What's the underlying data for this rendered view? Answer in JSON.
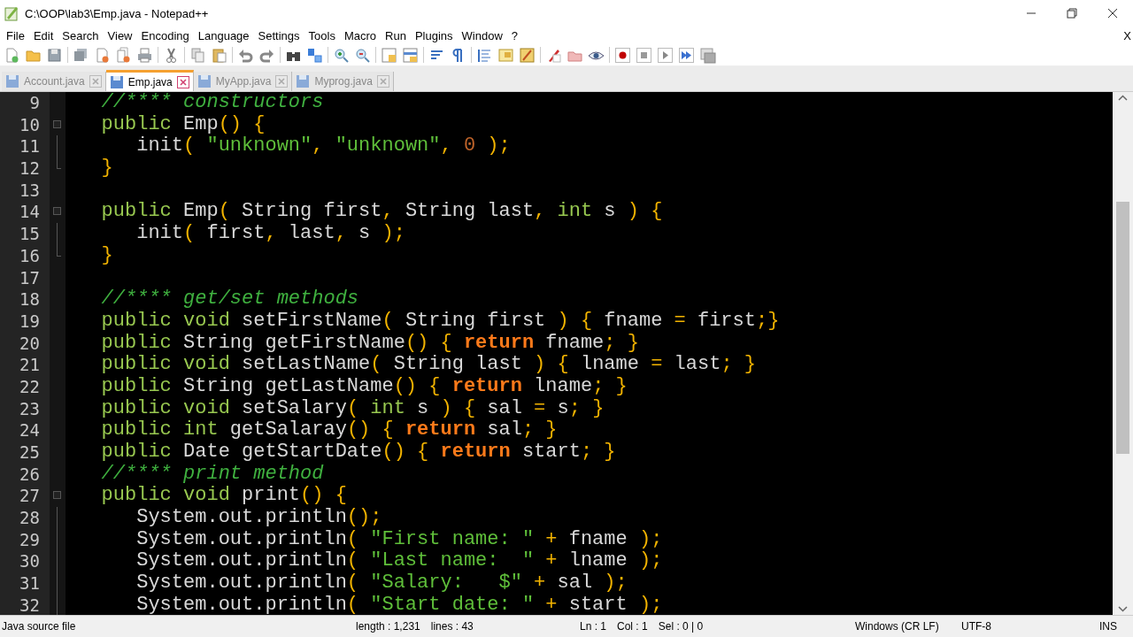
{
  "window": {
    "title": "C:\\OOP\\lab3\\Emp.java - Notepad++",
    "close_document": "X"
  },
  "menu": [
    "File",
    "Edit",
    "Search",
    "View",
    "Encoding",
    "Language",
    "Settings",
    "Tools",
    "Macro",
    "Run",
    "Plugins",
    "Window",
    "?"
  ],
  "tabs": [
    {
      "label": "Account.java",
      "selected": false
    },
    {
      "label": "Emp.java",
      "selected": true
    },
    {
      "label": "MyApp.java",
      "selected": false
    },
    {
      "label": "Myprog.java",
      "selected": false
    }
  ],
  "editor": {
    "lines": [
      {
        "number": "9",
        "kind": "plain",
        "tokens": [
          {
            "kind": "comment",
            "text": "   //**** constructors"
          }
        ]
      },
      {
        "number": "10",
        "kind": "fold_start",
        "tokens": [
          {
            "kind": "keyword",
            "text": "   public"
          },
          {
            "kind": "plain",
            "text": " Emp"
          },
          {
            "kind": "operator",
            "text": "()"
          },
          {
            "kind": "operator",
            "text": " {"
          }
        ]
      },
      {
        "number": "11",
        "kind": "fold_body",
        "tokens": [
          {
            "kind": "plain",
            "text": "      init"
          },
          {
            "kind": "operator",
            "text": "("
          },
          {
            "kind": "string",
            "text": " \"unknown\""
          },
          {
            "kind": "operator",
            "text": ","
          },
          {
            "kind": "string",
            "text": " \"unknown\""
          },
          {
            "kind": "operator",
            "text": ","
          },
          {
            "kind": "number",
            "text": " 0"
          },
          {
            "kind": "operator",
            "text": " );"
          }
        ]
      },
      {
        "number": "12",
        "kind": "fold_end",
        "tokens": [
          {
            "kind": "operator",
            "text": "   }"
          }
        ]
      },
      {
        "number": "13",
        "kind": "plain"
      },
      {
        "number": "14",
        "kind": "fold_start",
        "tokens": [
          {
            "kind": "keyword",
            "text": "   public"
          },
          {
            "kind": "plain",
            "text": " Emp"
          },
          {
            "kind": "operator",
            "text": "("
          },
          {
            "kind": "plain",
            "text": " String first"
          },
          {
            "kind": "operator",
            "text": ","
          },
          {
            "kind": "plain",
            "text": " String last"
          },
          {
            "kind": "operator",
            "text": ","
          },
          {
            "kind": "keyword",
            "text": " int"
          },
          {
            "kind": "plain",
            "text": " s"
          },
          {
            "kind": "operator",
            "text": " )"
          },
          {
            "kind": "operator",
            "text": " {"
          }
        ]
      },
      {
        "number": "15",
        "kind": "fold_body",
        "tokens": [
          {
            "kind": "plain",
            "text": "      init"
          },
          {
            "kind": "operator",
            "text": "("
          },
          {
            "kind": "plain",
            "text": " first"
          },
          {
            "kind": "operator",
            "text": ","
          },
          {
            "kind": "plain",
            "text": " last"
          },
          {
            "kind": "operator",
            "text": ","
          },
          {
            "kind": "plain",
            "text": " s"
          },
          {
            "kind": "operator",
            "text": " );"
          }
        ]
      },
      {
        "number": "16",
        "kind": "fold_end",
        "tokens": [
          {
            "kind": "operator",
            "text": "   }"
          }
        ]
      },
      {
        "number": "17",
        "kind": "plain"
      },
      {
        "number": "18",
        "kind": "plain",
        "tokens": [
          {
            "kind": "comment",
            "text": "   //**** get/set methods"
          }
        ]
      },
      {
        "number": "19",
        "kind": "plain",
        "tokens": [
          {
            "kind": "keyword",
            "text": "   public"
          },
          {
            "kind": "keyword",
            "text": " void"
          },
          {
            "kind": "plain",
            "text": " setFirstName"
          },
          {
            "kind": "operator",
            "text": "("
          },
          {
            "kind": "plain",
            "text": " String first"
          },
          {
            "kind": "operator",
            "text": " )"
          },
          {
            "kind": "operator",
            "text": " {"
          },
          {
            "kind": "plain",
            "text": " fname"
          },
          {
            "kind": "operator",
            "text": " ="
          },
          {
            "kind": "plain",
            "text": " first"
          },
          {
            "kind": "operator",
            "text": ";}"
          }
        ]
      },
      {
        "number": "20",
        "kind": "plain",
        "tokens": [
          {
            "kind": "keyword",
            "text": "   public"
          },
          {
            "kind": "plain",
            "text": " String getFirstName"
          },
          {
            "kind": "operator",
            "text": "()"
          },
          {
            "kind": "operator",
            "text": " {"
          },
          {
            "kind": "return",
            "text": " return"
          },
          {
            "kind": "plain",
            "text": " fname"
          },
          {
            "kind": "operator",
            "text": ";"
          },
          {
            "kind": "operator",
            "text": " }"
          }
        ]
      },
      {
        "number": "21",
        "kind": "plain",
        "tokens": [
          {
            "kind": "keyword",
            "text": "   public"
          },
          {
            "kind": "keyword",
            "text": " void"
          },
          {
            "kind": "plain",
            "text": " setLastName"
          },
          {
            "kind": "operator",
            "text": "("
          },
          {
            "kind": "plain",
            "text": " String last"
          },
          {
            "kind": "operator",
            "text": " )"
          },
          {
            "kind": "operator",
            "text": " {"
          },
          {
            "kind": "plain",
            "text": " lname"
          },
          {
            "kind": "operator",
            "text": " ="
          },
          {
            "kind": "plain",
            "text": " last"
          },
          {
            "kind": "operator",
            "text": ";"
          },
          {
            "kind": "operator",
            "text": " }"
          }
        ]
      },
      {
        "number": "22",
        "kind": "plain",
        "tokens": [
          {
            "kind": "keyword",
            "text": "   public"
          },
          {
            "kind": "plain",
            "text": " String getLastName"
          },
          {
            "kind": "operator",
            "text": "()"
          },
          {
            "kind": "operator",
            "text": " {"
          },
          {
            "kind": "return",
            "text": " return"
          },
          {
            "kind": "plain",
            "text": " lname"
          },
          {
            "kind": "operator",
            "text": ";"
          },
          {
            "kind": "operator",
            "text": " }"
          }
        ]
      },
      {
        "number": "23",
        "kind": "plain",
        "tokens": [
          {
            "kind": "keyword",
            "text": "   public"
          },
          {
            "kind": "keyword",
            "text": " void"
          },
          {
            "kind": "plain",
            "text": " setSalary"
          },
          {
            "kind": "operator",
            "text": "("
          },
          {
            "kind": "keyword",
            "text": " int"
          },
          {
            "kind": "plain",
            "text": " s"
          },
          {
            "kind": "operator",
            "text": " )"
          },
          {
            "kind": "operator",
            "text": " {"
          },
          {
            "kind": "plain",
            "text": " sal"
          },
          {
            "kind": "operator",
            "text": " ="
          },
          {
            "kind": "plain",
            "text": " s"
          },
          {
            "kind": "operator",
            "text": ";"
          },
          {
            "kind": "operator",
            "text": " }"
          }
        ]
      },
      {
        "number": "24",
        "kind": "plain",
        "tokens": [
          {
            "kind": "keyword",
            "text": "   public"
          },
          {
            "kind": "keyword",
            "text": " int"
          },
          {
            "kind": "plain",
            "text": " getSalaray"
          },
          {
            "kind": "operator",
            "text": "()"
          },
          {
            "kind": "operator",
            "text": " {"
          },
          {
            "kind": "return",
            "text": " return"
          },
          {
            "kind": "plain",
            "text": " sal"
          },
          {
            "kind": "operator",
            "text": ";"
          },
          {
            "kind": "operator",
            "text": " }"
          }
        ]
      },
      {
        "number": "25",
        "kind": "plain",
        "tokens": [
          {
            "kind": "keyword",
            "text": "   public"
          },
          {
            "kind": "plain",
            "text": " Date getStartDate"
          },
          {
            "kind": "operator",
            "text": "()"
          },
          {
            "kind": "operator",
            "text": " {"
          },
          {
            "kind": "return",
            "text": " return"
          },
          {
            "kind": "plain",
            "text": " start"
          },
          {
            "kind": "operator",
            "text": ";"
          },
          {
            "kind": "operator",
            "text": " }"
          }
        ]
      },
      {
        "number": "26",
        "kind": "plain",
        "tokens": [
          {
            "kind": "comment",
            "text": "   //**** print method"
          }
        ]
      },
      {
        "number": "27",
        "kind": "fold_start",
        "tokens": [
          {
            "kind": "keyword",
            "text": "   public"
          },
          {
            "kind": "keyword",
            "text": " void"
          },
          {
            "kind": "plain",
            "text": " print"
          },
          {
            "kind": "operator",
            "text": "()"
          },
          {
            "kind": "operator",
            "text": " {"
          }
        ]
      },
      {
        "number": "28",
        "kind": "fold_body",
        "tokens": [
          {
            "kind": "plain",
            "text": "      System.out.println"
          },
          {
            "kind": "operator",
            "text": "();"
          }
        ]
      },
      {
        "number": "29",
        "kind": "fold_body",
        "tokens": [
          {
            "kind": "plain",
            "text": "      System.out.println"
          },
          {
            "kind": "operator",
            "text": "("
          },
          {
            "kind": "string",
            "text": " \"First name: \""
          },
          {
            "kind": "operator",
            "text": " +"
          },
          {
            "kind": "plain",
            "text": " fname"
          },
          {
            "kind": "operator",
            "text": " );"
          }
        ]
      },
      {
        "number": "30",
        "kind": "fold_body",
        "tokens": [
          {
            "kind": "plain",
            "text": "      System.out.println"
          },
          {
            "kind": "operator",
            "text": "("
          },
          {
            "kind": "string",
            "text": " \"Last name:  \""
          },
          {
            "kind": "operator",
            "text": " +"
          },
          {
            "kind": "plain",
            "text": " lname"
          },
          {
            "kind": "operator",
            "text": " );"
          }
        ]
      },
      {
        "number": "31",
        "kind": "fold_body",
        "tokens": [
          {
            "kind": "plain",
            "text": "      System.out.println"
          },
          {
            "kind": "operator",
            "text": "("
          },
          {
            "kind": "string",
            "text": " \"Salary:   $\""
          },
          {
            "kind": "operator",
            "text": " +"
          },
          {
            "kind": "plain",
            "text": " sal"
          },
          {
            "kind": "operator",
            "text": " );"
          }
        ]
      },
      {
        "number": "32",
        "kind": "fold_body",
        "tokens": [
          {
            "kind": "plain",
            "text": "      System.out.println"
          },
          {
            "kind": "operator",
            "text": "("
          },
          {
            "kind": "string",
            "text": " \"Start date: \""
          },
          {
            "kind": "operator",
            "text": " +"
          },
          {
            "kind": "plain",
            "text": " start"
          },
          {
            "kind": "operator",
            "text": " );"
          }
        ]
      }
    ]
  },
  "status_bar": {
    "file_type": "Java source file",
    "length": "length : 1,231",
    "lines": "lines : 43",
    "line": "Ln : 1",
    "column": "Col : 1",
    "selection": "Sel : 0 | 0",
    "eol": "Windows (CR LF)",
    "encoding": "UTF-8",
    "mode": "INS"
  }
}
